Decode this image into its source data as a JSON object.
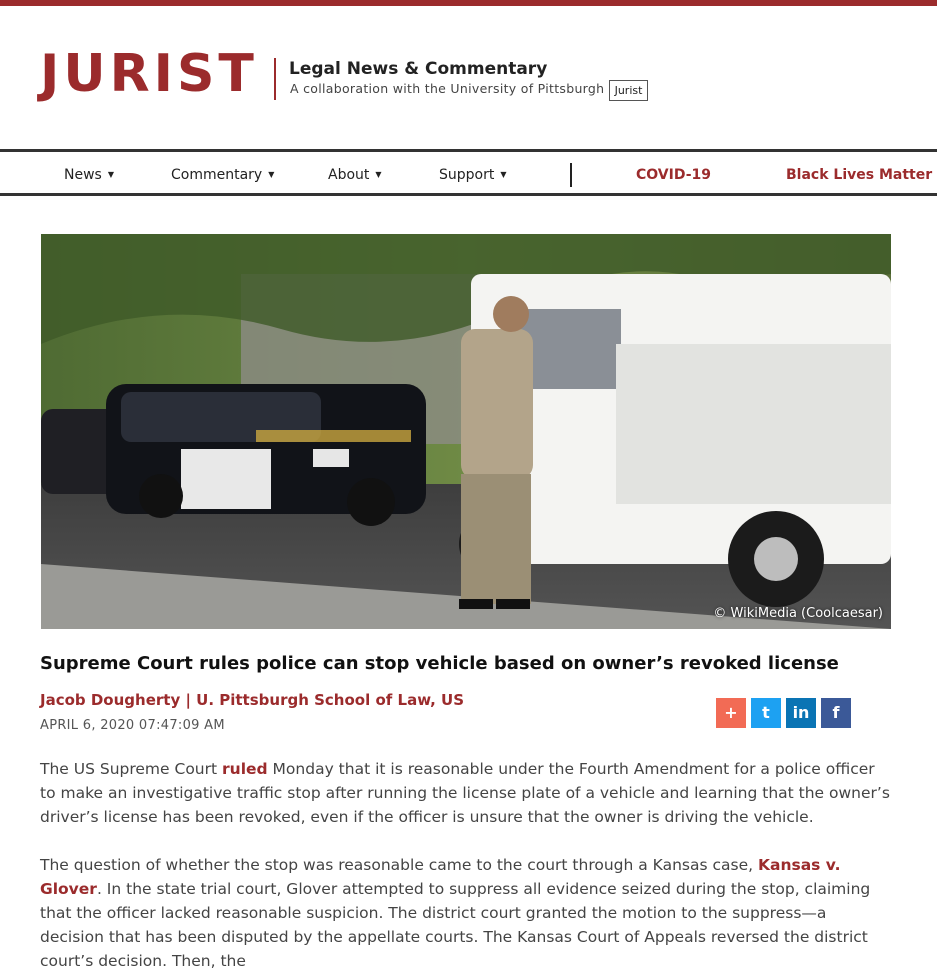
{
  "header": {
    "logo": "JURIST",
    "tagline": "Legal News & Commentary",
    "subtagline": "A collaboration with  the University of Pittsburgh",
    "tooltip": "Jurist"
  },
  "nav": {
    "items": [
      {
        "label": "News"
      },
      {
        "label": "Commentary"
      },
      {
        "label": "About"
      },
      {
        "label": "Support"
      }
    ],
    "highlight": [
      {
        "label": "COVID-19"
      },
      {
        "label": "Black Lives Matter"
      }
    ]
  },
  "article": {
    "image_credit": "© WikiMedia (Coolcaesar)",
    "title": "Supreme Court rules police can stop vehicle based on owner’s revoked license",
    "byline": "Jacob Dougherty | U. Pittsburgh School of Law, US",
    "date": "APRIL 6, 2020 07:47:09 AM",
    "p1_before": "The US Supreme Court ",
    "p1_link": "ruled",
    "p1_after": " Monday that it is reasonable under the Fourth Amendment for a police officer to make an investigative traffic stop after running the license plate of a vehicle and learning that the owner’s driver’s license has been revoked, even if the officer is unsure that the owner is driving the vehicle.",
    "p2_before": "The question of whether the stop was reasonable came to the court through a Kansas case, ",
    "p2_link": "Kansas v. Glover",
    "p2_after": ". In the state trial court, Glover attempted to suppress all evidence seized during the stop, claiming that the officer lacked reasonable suspicion. The district court granted the motion to the suppress—a decision that has been disputed by the appellate courts. The Kansas Court of Appeals reversed the district court’s decision. Then, the"
  },
  "share": [
    {
      "icon": "plus-icon",
      "glyph": "+",
      "color": "#f26b55"
    },
    {
      "icon": "twitter-icon",
      "glyph": "t",
      "color": "#1da1f2"
    },
    {
      "icon": "linkedin-icon",
      "glyph": "in",
      "color": "#0a74b4"
    },
    {
      "icon": "facebook-icon",
      "glyph": "f",
      "color": "#3b5998"
    }
  ],
  "colors": {
    "brand": "#9b2b2c"
  }
}
